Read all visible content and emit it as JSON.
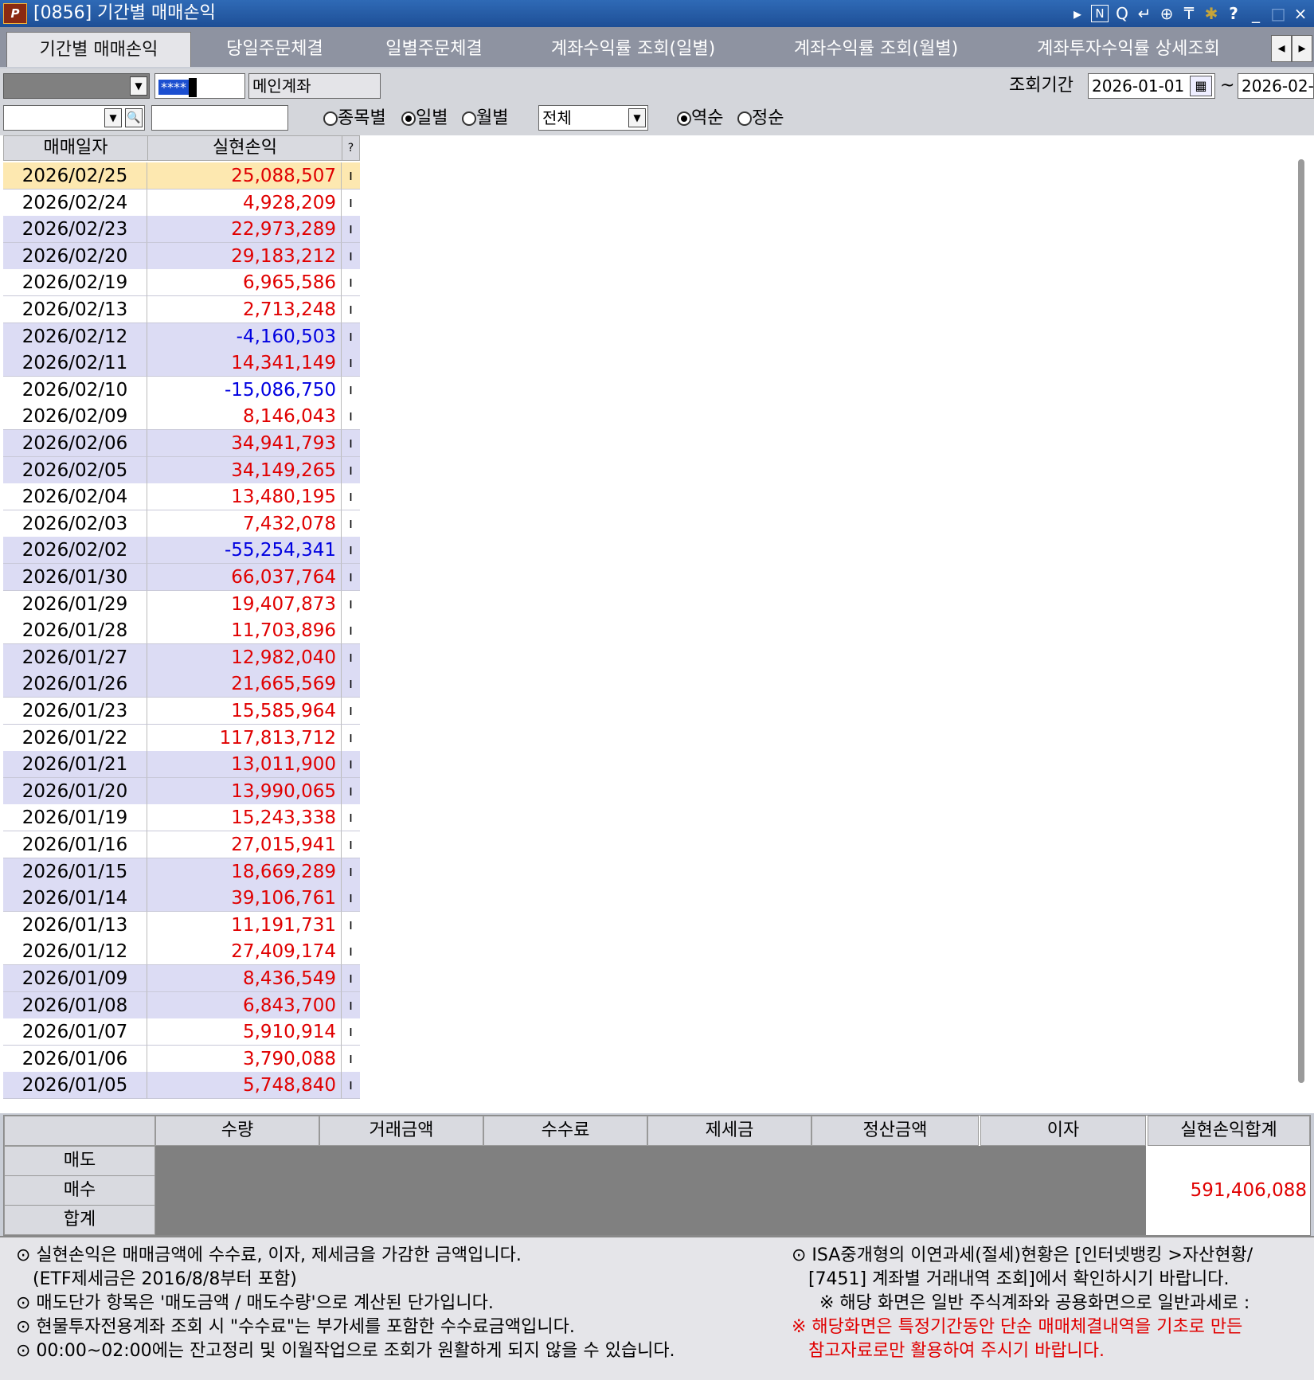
{
  "window": {
    "title": "[0856] 기간별 매매손익",
    "toolbar_icons": [
      "arrow-right-icon",
      "n-icon",
      "search-icon",
      "back-icon",
      "zoom-icon",
      "pin-icon",
      "star-icon",
      "help-icon",
      "minimize-icon",
      "maximize-icon",
      "close-icon"
    ],
    "toolbar_glyphs": {
      "arrow": "▸",
      "n": "N",
      "search": "Q",
      "back": "↵",
      "zoom": "⊕",
      "pin": "₸",
      "star": "✱",
      "help": "?",
      "min": "_",
      "max": "□",
      "close": "×"
    }
  },
  "tabs": [
    {
      "label": "기간별 매매손익",
      "active": true
    },
    {
      "label": "당일주문체결"
    },
    {
      "label": "일별주문체결"
    },
    {
      "label": "계좌수익률 조회(일별)"
    },
    {
      "label": "계좌수익률 조회(월별)"
    },
    {
      "label": "계좌투자수익률 상세조회"
    }
  ],
  "account": {
    "masked_password": "****",
    "account_name": "메인계좌"
  },
  "period": {
    "label": "조회기간",
    "start": "2026-01-01",
    "separator": "~",
    "end": "2026-02-"
  },
  "filters": {
    "radio_by_item": "종목별",
    "radio_daily": "일별",
    "radio_monthly": "월별",
    "select_value": "전체",
    "radio_desc": "역순",
    "radio_asc": "정순"
  },
  "grid": {
    "headers": [
      "매매일자",
      "실현손익"
    ],
    "extra_header": "?",
    "rows": [
      {
        "date": "2026/02/25",
        "pnl": "25,088,507",
        "neg": false,
        "selected": true
      },
      {
        "date": "2026/02/24",
        "pnl": "4,928,209",
        "neg": false
      },
      {
        "date": "2026/02/23",
        "pnl": "22,973,289",
        "neg": false
      },
      {
        "date": "2026/02/20",
        "pnl": "29,183,212",
        "neg": false
      },
      {
        "date": "2026/02/19",
        "pnl": "6,965,586",
        "neg": false
      },
      {
        "date": "2026/02/13",
        "pnl": "2,713,248",
        "neg": false
      },
      {
        "date": "2026/02/12",
        "pnl": "-4,160,503",
        "neg": true
      },
      {
        "date": "2026/02/11",
        "pnl": "14,341,149",
        "neg": false
      },
      {
        "date": "2026/02/10",
        "pnl": "-15,086,750",
        "neg": true
      },
      {
        "date": "2026/02/09",
        "pnl": "8,146,043",
        "neg": false
      },
      {
        "date": "2026/02/06",
        "pnl": "34,941,793",
        "neg": false
      },
      {
        "date": "2026/02/05",
        "pnl": "34,149,265",
        "neg": false
      },
      {
        "date": "2026/02/04",
        "pnl": "13,480,195",
        "neg": false
      },
      {
        "date": "2026/02/03",
        "pnl": "7,432,078",
        "neg": false
      },
      {
        "date": "2026/02/02",
        "pnl": "-55,254,341",
        "neg": true
      },
      {
        "date": "2026/01/30",
        "pnl": "66,037,764",
        "neg": false
      },
      {
        "date": "2026/01/29",
        "pnl": "19,407,873",
        "neg": false
      },
      {
        "date": "2026/01/28",
        "pnl": "11,703,896",
        "neg": false
      },
      {
        "date": "2026/01/27",
        "pnl": "12,982,040",
        "neg": false
      },
      {
        "date": "2026/01/26",
        "pnl": "21,665,569",
        "neg": false
      },
      {
        "date": "2026/01/23",
        "pnl": "15,585,964",
        "neg": false
      },
      {
        "date": "2026/01/22",
        "pnl": "117,813,712",
        "neg": false
      },
      {
        "date": "2026/01/21",
        "pnl": "13,011,900",
        "neg": false
      },
      {
        "date": "2026/01/20",
        "pnl": "13,990,065",
        "neg": false
      },
      {
        "date": "2026/01/19",
        "pnl": "15,243,338",
        "neg": false
      },
      {
        "date": "2026/01/16",
        "pnl": "27,015,941",
        "neg": false
      },
      {
        "date": "2026/01/15",
        "pnl": "18,669,289",
        "neg": false
      },
      {
        "date": "2026/01/14",
        "pnl": "39,106,761",
        "neg": false
      },
      {
        "date": "2026/01/13",
        "pnl": "11,191,731",
        "neg": false
      },
      {
        "date": "2026/01/12",
        "pnl": "27,409,174",
        "neg": false
      },
      {
        "date": "2026/01/09",
        "pnl": "8,436,549",
        "neg": false
      },
      {
        "date": "2026/01/08",
        "pnl": "6,843,700",
        "neg": false
      },
      {
        "date": "2026/01/07",
        "pnl": "5,910,914",
        "neg": false
      },
      {
        "date": "2026/01/06",
        "pnl": "3,790,088",
        "neg": false
      },
      {
        "date": "2026/01/05",
        "pnl": "5,748,840",
        "neg": false
      }
    ]
  },
  "summary": {
    "headers": [
      "수량",
      "거래금액",
      "수수료",
      "제세금",
      "정산금액",
      "이자",
      "실현손익합계"
    ],
    "rows": [
      "매도",
      "매수",
      "합계"
    ],
    "total_realized": "591,406,088"
  },
  "notes_left": [
    "⊙ 실현손익은 매매금액에 수수료, 이자, 제세금을 가감한 금액입니다.",
    "   (ETF제세금은 2016/8/8부터 포함)",
    "⊙ 매도단가 항목은 '매도금액 / 매도수량'으로 계산된 단가입니다.",
    "⊙ 현물투자전용계좌 조회 시 \"수수료\"는 부가세를 포함한 수수료금액입니다.",
    "⊙ 00:00~02:00에는 잔고정리 및 이월작업으로 조회가 원활하게 되지 않을 수 있습니다."
  ],
  "notes_right": [
    "⊙ ISA중개형의 이연과세(절세)현황은 [인터넷뱅킹 >자산현황/",
    "   [7451] 계좌별 거래내역 조회]에서 확인하시기 바랍니다.",
    "     ※ 해당 화면은 일반 주식계좌와 공용화면으로 일반과세로 :"
  ],
  "notes_right_red": [
    "※ 해당화면은 특정기간동안 단순 매매체결내역을 기초로 만든",
    "   참고자료로만 활용하여 주시기 바랍니다."
  ],
  "colors": {
    "positive": "#e00000",
    "negative": "#0000e0",
    "row_lavender": "#dcdcf4",
    "row_white": "#ffffff",
    "row_selected": "#fde8b0"
  }
}
